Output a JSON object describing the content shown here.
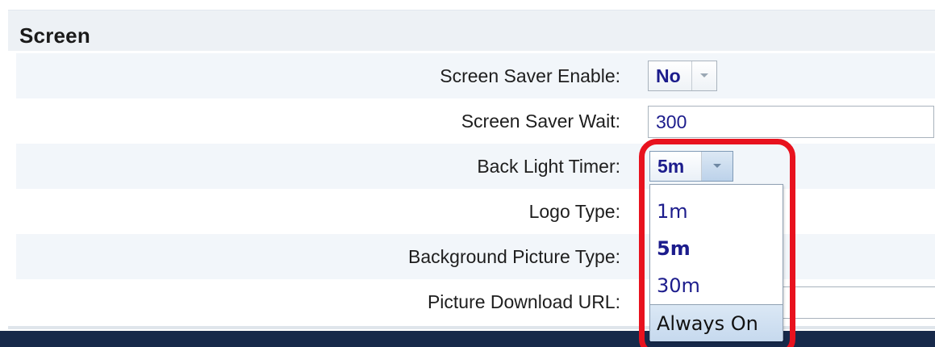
{
  "section": {
    "title": "Screen"
  },
  "fields": {
    "screen_saver_enable": {
      "label": "Screen Saver Enable:",
      "value": "No"
    },
    "screen_saver_wait": {
      "label": "Screen Saver Wait:",
      "value": "300"
    },
    "back_light_timer": {
      "label": "Back Light Timer:",
      "value": "5m"
    },
    "logo_type": {
      "label": "Logo Type:"
    },
    "background_picture_type": {
      "label": "Background Picture Type:"
    },
    "picture_download_url": {
      "label": "Picture Download URL:"
    }
  },
  "back_light_dropdown": {
    "options": [
      "1m",
      "5m",
      "30m",
      "Always On"
    ],
    "selected": "5m",
    "hovered": "Always On"
  },
  "colors": {
    "highlight_ring": "#e8121e",
    "value_text": "#1c1c8c",
    "row_shade": "#f2f6fa",
    "header_bg": "#edf1f5",
    "bottom_bar": "#17294a"
  },
  "icons": {
    "select_arrow": "chevron-down-icon"
  }
}
